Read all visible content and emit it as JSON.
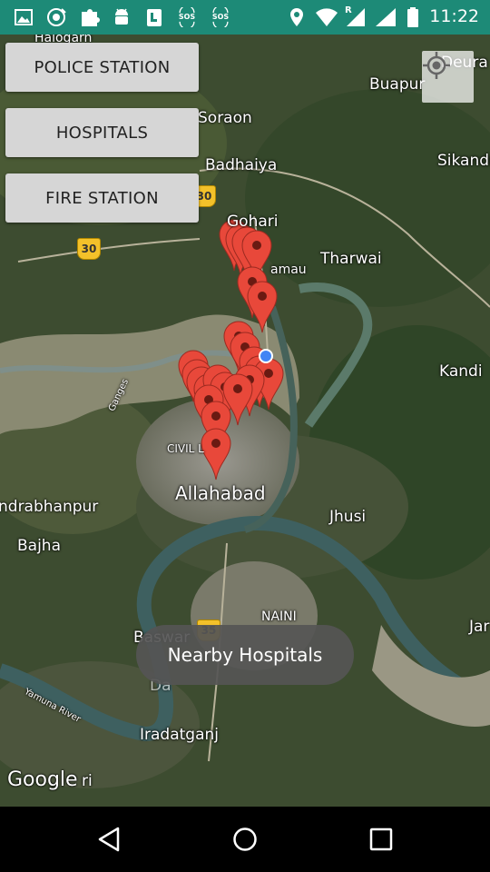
{
  "status_bar": {
    "time": "11:22",
    "sos_label_1": "SOS",
    "sos_label_2": "SOS",
    "roaming_label": "R"
  },
  "buttons": {
    "police": "POLICE STATION",
    "hospitals": "HOSPITALS",
    "fire": "FIRE STATION"
  },
  "map": {
    "places": {
      "halogarh": "Halogarh",
      "deura": "Deura",
      "buapur": "Buapur",
      "soraon": "Soraon",
      "sikandra": "Sikandr",
      "badhaiya": "Badhaiya",
      "gohari": "Gohari",
      "tharwai": "Tharwai",
      "amau": "amau",
      "kandi": "Kandi",
      "ganges": "Ganges",
      "civil": "CIVIL L",
      "allahabad": "Allahabad",
      "jhusi": "Jhusi",
      "chandrabhanpur": "ndrabhanpur",
      "bajha": "Bajha",
      "naini": "NAINI",
      "baswar": "Baswar",
      "jar": "Jar",
      "yamuna": "Yamuna River",
      "iradatganj": "Iradatganj",
      "da": "Da",
      "ri": "ri"
    },
    "highway_shields": [
      "30",
      "30",
      "35"
    ],
    "marker_color": "#e8483a",
    "location_dot_color": "#4285f4",
    "google_logo": "Google"
  },
  "toast": "Nearby Hospitals",
  "colors": {
    "status_bar": "#1d8a77",
    "button_bg": "#d6d6d6"
  }
}
